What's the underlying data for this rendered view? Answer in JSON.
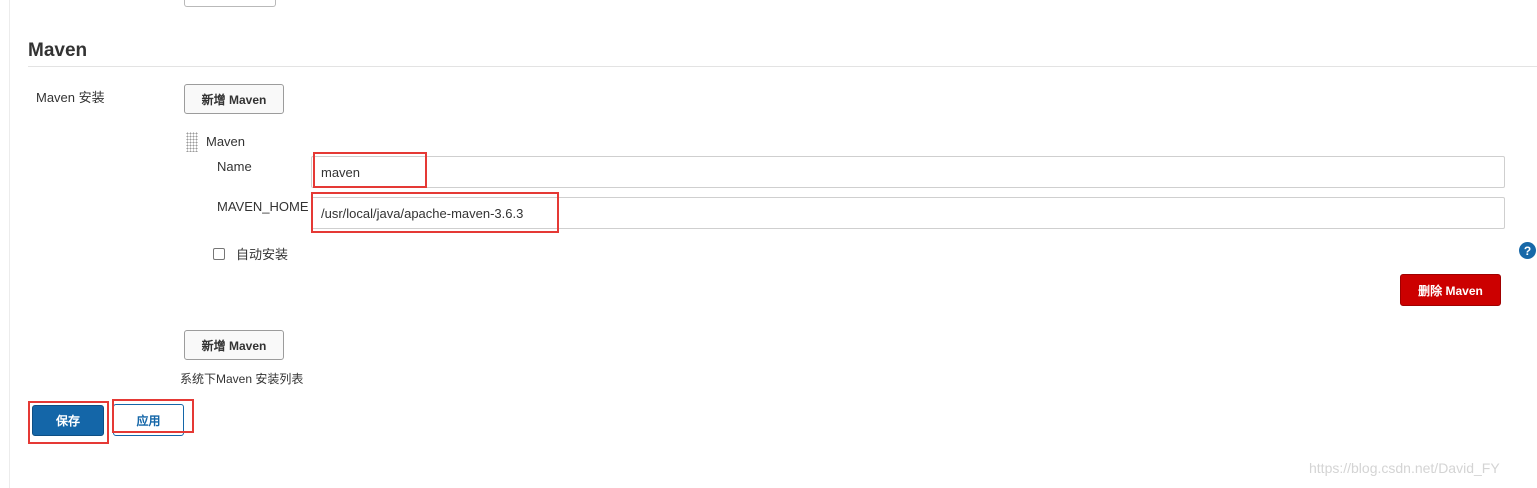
{
  "section": {
    "title": "Maven",
    "installations_label": "Maven 安装",
    "add_button_label": "新增 Maven",
    "description": "系统下Maven 安装列表"
  },
  "installation": {
    "title": "Maven",
    "name_label": "Name",
    "name_value": "maven",
    "home_label": "MAVEN_HOME",
    "home_value": "/usr/local/java/apache-maven-3.6.3",
    "auto_install_label": "自动安装",
    "auto_install_checked": false,
    "delete_button_label": "删除 Maven",
    "help_icon": "?"
  },
  "footer": {
    "save_label": "保存",
    "apply_label": "应用"
  },
  "watermark": "https://blog.csdn.net/David_FY",
  "colors": {
    "primary": "#1466a8",
    "danger": "#cc0000",
    "highlight": "#e53935"
  }
}
